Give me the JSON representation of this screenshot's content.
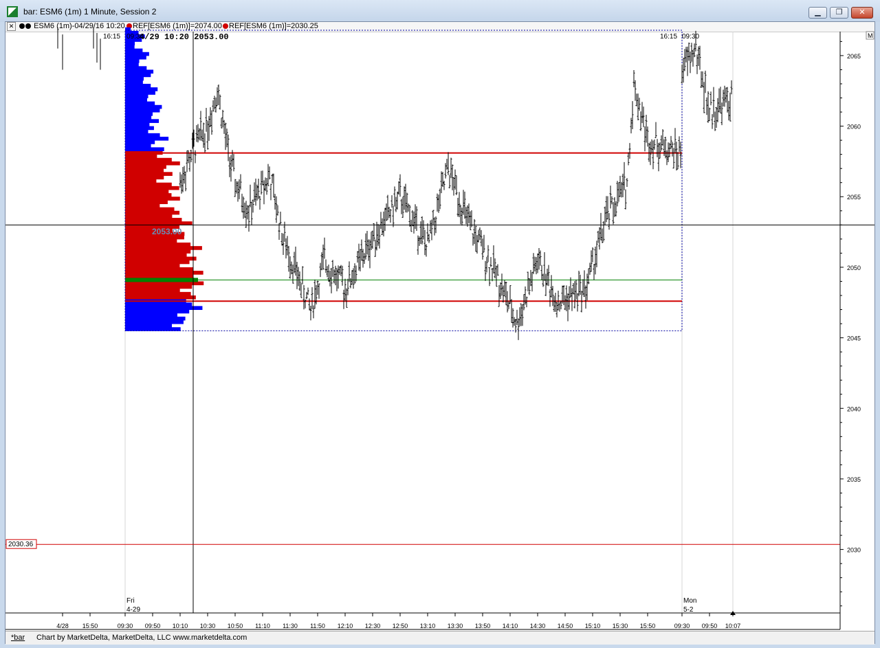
{
  "window": {
    "title": "bar: ESM6 (1m) 1 Minute, Session 2",
    "minimize_icon": "minimize-icon",
    "maximize_icon": "restore-icon",
    "close_icon": "close-icon"
  },
  "header": {
    "close_glyph": "✕",
    "series_label": "ESM6 (1m)-04/29/16 10:20",
    "ref1_label": "REF[ESM6 (1m)]=2074.00",
    "ref2_label": "REF[ESM6 (1m)]=2030.25",
    "m_label": "M",
    "ref_color": "#d00000"
  },
  "chart": {
    "session_open_left": "16:15",
    "session_open_right_a": "09:30",
    "session_close_right": "16:15",
    "session_open_right_b": "09:30",
    "cursor_readout": "4/29 10:20   2053.00",
    "crosshair_price_label": "2053.00",
    "ref_price_tag": "2030.36",
    "day_fri": "Fri",
    "day_fri_date": "4-29",
    "day_mon": "Mon",
    "day_mon_date": "5-2",
    "colors": {
      "profile_upper": "#0000ff",
      "profile_value_area": "#d00000",
      "poc": "#008000",
      "hline_red": "#d00000",
      "box": "#0000a0",
      "bars": "#000000"
    }
  },
  "chart_data": {
    "type": "bar",
    "price_axis": {
      "ticks": [
        "2065",
        "2060",
        "2055",
        "2050",
        "2045",
        "2040",
        "2035",
        "2030"
      ],
      "range": [
        2025.5,
        2066.7
      ]
    },
    "time_axis": {
      "ticks": [
        "4/28",
        "15:50",
        "09:30",
        "09:50",
        "10:10",
        "10:30",
        "10:50",
        "11:10",
        "11:30",
        "11:50",
        "12:10",
        "12:30",
        "12:50",
        "13:10",
        "13:30",
        "13:50",
        "14:10",
        "14:30",
        "14:50",
        "15:10",
        "15:30",
        "15:50",
        "09:30",
        "09:50",
        "10:07"
      ]
    },
    "levels": {
      "value_area_high": 2058.1,
      "value_area_low": 2047.6,
      "point_of_control": 2049.1,
      "crosshair_price": 2053.0,
      "reference_price": 2030.36,
      "profile_high": 2066.8,
      "profile_low": 2045.5
    },
    "price_path": [
      {
        "t": "10:10",
        "p": 2056.0
      },
      {
        "t": "10:20",
        "p": 2058.5
      },
      {
        "t": "10:30",
        "p": 2060.0
      },
      {
        "t": "10:37",
        "p": 2062.7
      },
      {
        "t": "10:45",
        "p": 2058.0
      },
      {
        "t": "10:50",
        "p": 2056.0
      },
      {
        "t": "11:00",
        "p": 2054.0
      },
      {
        "t": "11:15",
        "p": 2056.5
      },
      {
        "t": "11:25",
        "p": 2052.0
      },
      {
        "t": "11:45",
        "p": 2047.0
      },
      {
        "t": "11:55",
        "p": 2050.5
      },
      {
        "t": "12:10",
        "p": 2048.5
      },
      {
        "t": "12:30",
        "p": 2052.0
      },
      {
        "t": "12:50",
        "p": 2055.0
      },
      {
        "t": "13:10",
        "p": 2051.5
      },
      {
        "t": "13:25",
        "p": 2057.0
      },
      {
        "t": "13:40",
        "p": 2053.0
      },
      {
        "t": "14:00",
        "p": 2049.5
      },
      {
        "t": "14:15",
        "p": 2046.0
      },
      {
        "t": "14:30",
        "p": 2050.5
      },
      {
        "t": "14:45",
        "p": 2047.5
      },
      {
        "t": "15:05",
        "p": 2048.5
      },
      {
        "t": "15:20",
        "p": 2053.5
      },
      {
        "t": "15:35",
        "p": 2056.0
      },
      {
        "t": "15:40",
        "p": 2063.0
      },
      {
        "t": "15:50",
        "p": 2059.0
      },
      {
        "t": "16:15",
        "p": 2058.0
      },
      {
        "t": "09:30",
        "p": 2064.0
      },
      {
        "t": "09:40",
        "p": 2065.5
      },
      {
        "t": "09:50",
        "p": 2061.0
      },
      {
        "t": "10:07",
        "p": 2062.0
      }
    ]
  },
  "footer": {
    "tab_label": "*bar",
    "credit": "Chart by MarketDelta, MarketDelta, LLC www.marketdelta.com"
  }
}
